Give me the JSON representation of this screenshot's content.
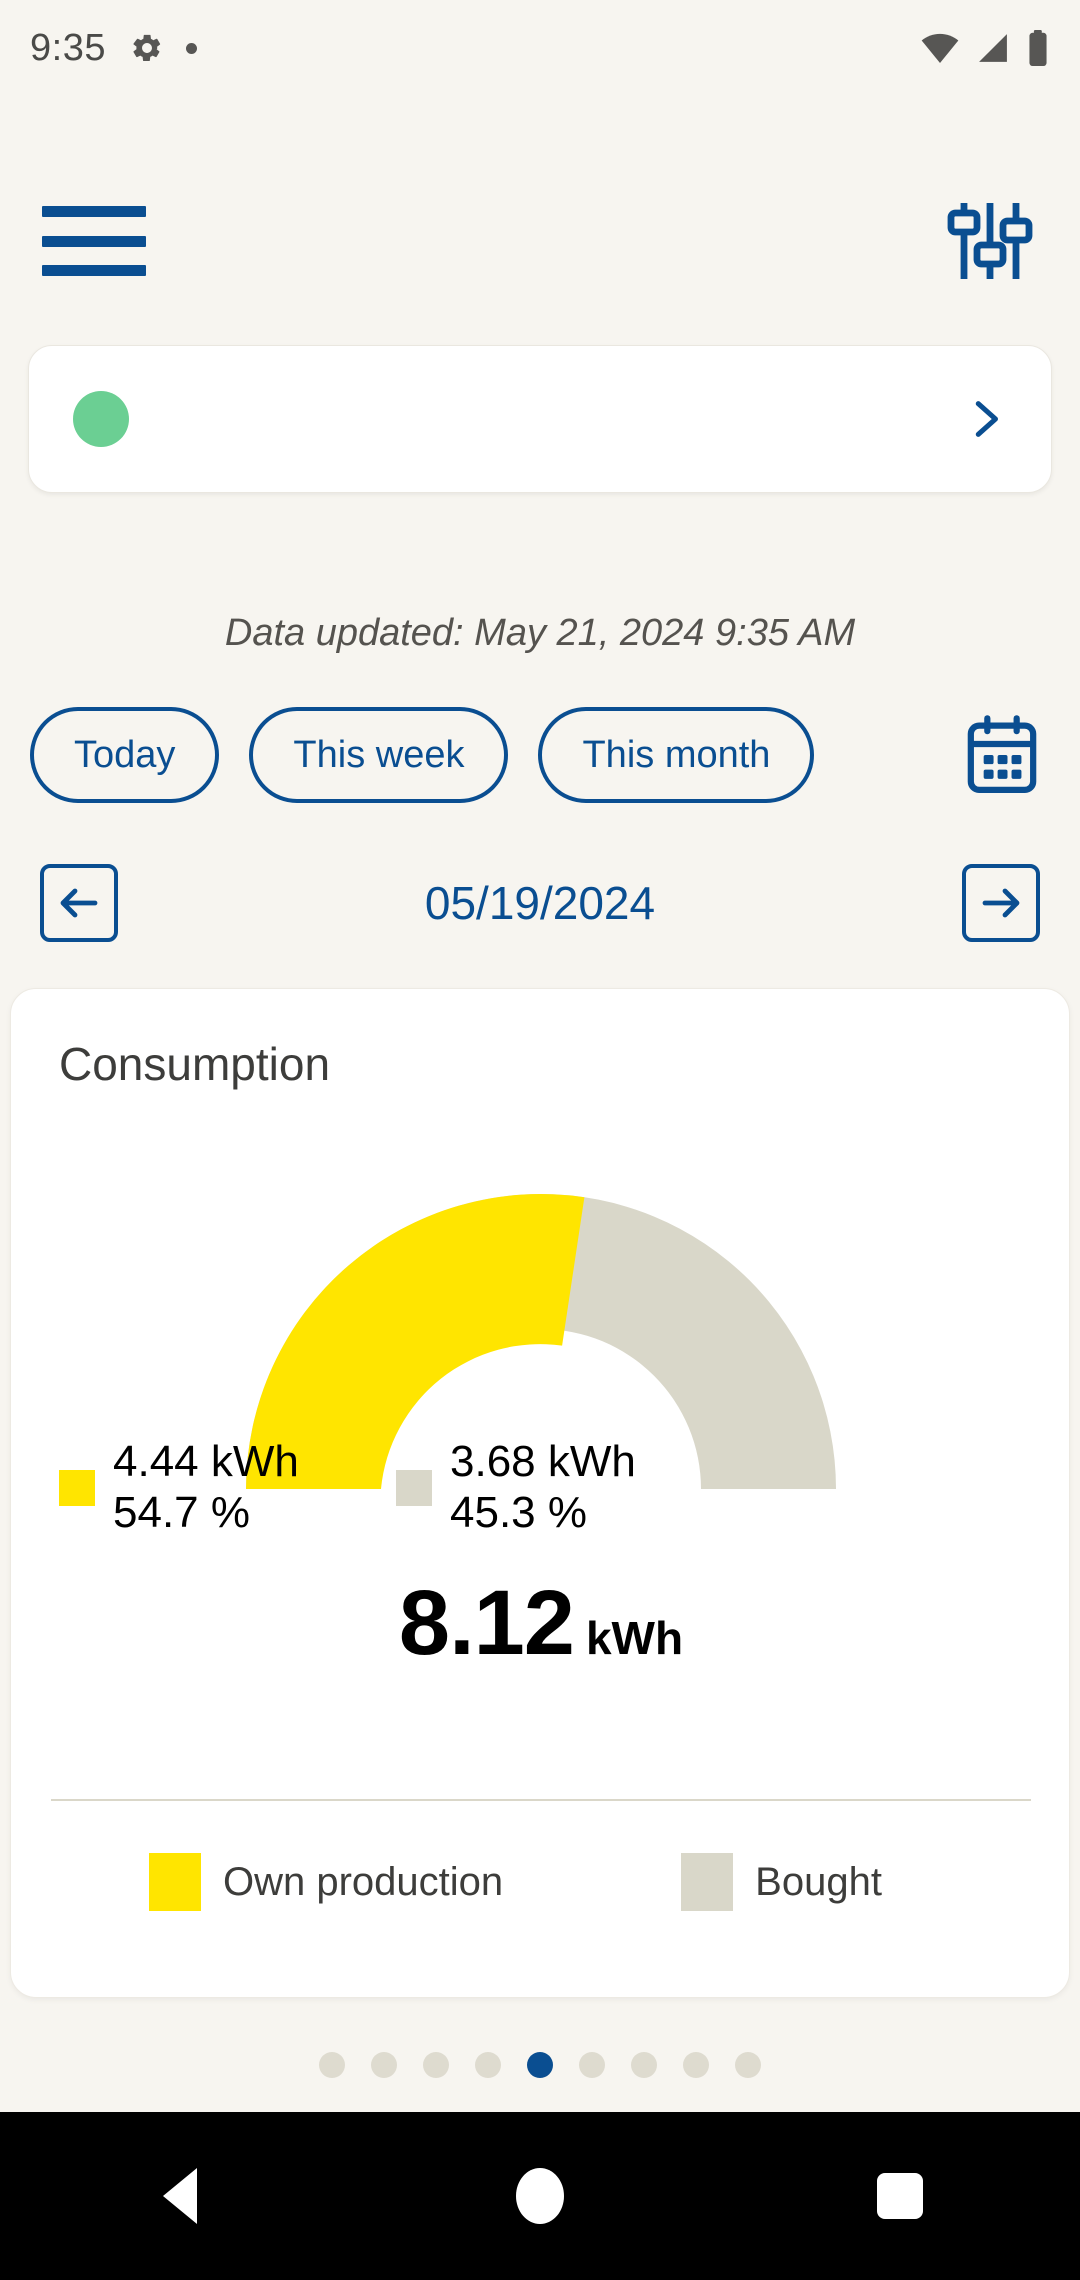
{
  "status_bar": {
    "time": "9:35",
    "icons": [
      "gear-icon",
      "dot-indicator",
      "wifi-icon",
      "cellular-signal-icon",
      "battery-icon"
    ]
  },
  "top_bar": {
    "menu_icon": "hamburger-menu-icon",
    "settings_icon": "tuner-sliders-icon"
  },
  "device_card": {
    "status_dot_color": "#6BCF93",
    "name": "",
    "chevron_icon": "chevron-right-icon"
  },
  "updated": {
    "text": "Data updated: May 21, 2024 9:35 AM"
  },
  "period_filters": {
    "chips": [
      {
        "label": "Today"
      },
      {
        "label": "This week"
      },
      {
        "label": "This month"
      }
    ],
    "calendar_icon": "calendar-icon"
  },
  "date_nav": {
    "prev_icon": "arrow-left-icon",
    "date": "05/19/2024",
    "next_icon": "arrow-right-icon"
  },
  "consumption_card": {
    "title": "Consumption",
    "left_value": "4.44 kWh",
    "left_percent": "54.7 %",
    "right_value": "3.68 kWh",
    "right_percent": "45.3 %",
    "total_value": "8.12",
    "total_unit": "kWh",
    "legend": [
      {
        "label": "Own production",
        "color": "#FFE500"
      },
      {
        "label": "Bought",
        "color": "#D9D7C9"
      }
    ]
  },
  "pager": {
    "total": 9,
    "active_index": 5
  },
  "nav_bar": {
    "back": "back-triangle-icon",
    "home": "home-circle-icon",
    "recents": "recents-square-icon"
  },
  "colors": {
    "background": "#F7F5F0",
    "brand_blue": "#0A4E91",
    "own_production": "#FFE500",
    "bought": "#D9D7C9",
    "status_green": "#6BCF93"
  },
  "chart_data": {
    "type": "pie",
    "title": "Consumption",
    "subtype": "semicircular-gauge-donut",
    "labels": [
      "Own production",
      "Bought"
    ],
    "values": [
      4.44,
      3.68
    ],
    "percentages": [
      54.7,
      45.3
    ],
    "colors": [
      "#FFE500",
      "#D9D7C9"
    ],
    "unit": "kWh",
    "total": 8.12,
    "total_label": "8.12 kWh",
    "legend_position": "bottom",
    "annotations": [
      "4.44 kWh",
      "54.7 %",
      "3.68 kWh",
      "45.3 %",
      "8.12 kWh"
    ],
    "start_angle": 180,
    "end_angle": 0
  }
}
